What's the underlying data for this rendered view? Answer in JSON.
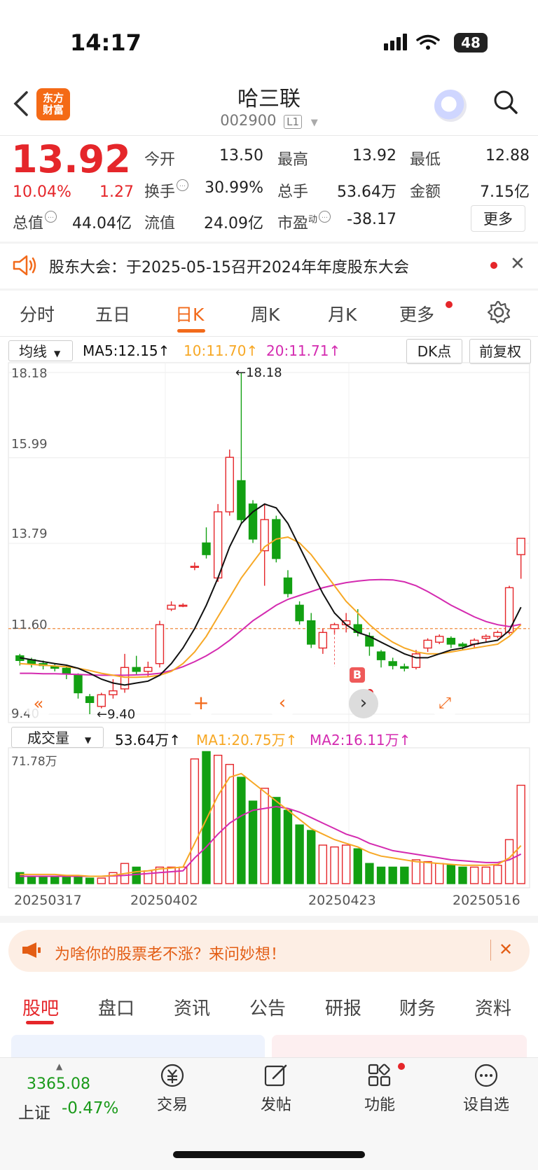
{
  "status_bar": {
    "time": "14:17",
    "battery": "48"
  },
  "header": {
    "back_icon": "chevron-left-icon",
    "logo_line1": "东方",
    "logo_line2": "财富",
    "title": "哈三联",
    "code": "002900",
    "level": "L1"
  },
  "quote": {
    "price": "13.92",
    "change_pct": "10.04%",
    "change": "1.27",
    "fields": [
      {
        "label": "今开",
        "value": "13.50",
        "color": "#e5262a"
      },
      {
        "label": "最高",
        "value": "13.92",
        "color": "#e5262a"
      },
      {
        "label": "最低",
        "value": "12.88",
        "color": "#e5262a"
      },
      {
        "label": "换手",
        "value": "30.99%",
        "color": "#222222"
      },
      {
        "label": "总手",
        "value": "53.64万",
        "color": "#222222"
      },
      {
        "label": "金额",
        "value": "7.15亿",
        "color": "#222222"
      },
      {
        "label": "总值",
        "value": "44.04亿",
        "color": "#222222"
      },
      {
        "label": "流值",
        "value": "24.09亿",
        "color": "#222222"
      },
      {
        "label": "市盈",
        "value": "-38.17",
        "color": "#222222"
      }
    ],
    "pe_superscript": "动",
    "more_label": "更多"
  },
  "notice": {
    "text": "股东大会：于2025-05-15召开2024年年度股东大会"
  },
  "chart_tabs": [
    "分时",
    "五日",
    "日K",
    "周K",
    "月K",
    "更多"
  ],
  "chart_tabs_active": 2,
  "ma_bar": {
    "select_label": "均线",
    "ma5": "MA5:12.15↑",
    "ma10": "10:11.70↑",
    "ma20": "20:11.71↑",
    "dk_label": "DK点",
    "adjust_label": "前复权"
  },
  "kline": {
    "y_labels": [
      "18.18",
      "15.99",
      "13.79",
      "11.60",
      "9.40"
    ],
    "max_label": "←18.18",
    "min_label": "←9.40",
    "b_marker": "B",
    "colors": {
      "up": "#e5262a",
      "down": "#12a012",
      "ma5": "#111111",
      "ma10": "#f7a825",
      "ma20": "#d42bb0"
    }
  },
  "volume_bar": {
    "select_label": "成交量",
    "value": "53.64万↑",
    "ma1": "MA1:20.75万↑",
    "ma2": "MA2:16.11万↑",
    "max_label": "71.78万"
  },
  "x_dates": [
    "20250317",
    "20250402",
    "20250423",
    "20250516"
  ],
  "chart_data": {
    "type": "candlestick",
    "ylim": [
      9.4,
      18.18
    ],
    "candles": [
      [
        10.9,
        10.78,
        10.95,
        10.65
      ],
      [
        10.8,
        10.7,
        10.85,
        10.6
      ],
      [
        10.7,
        10.65,
        10.78,
        10.55
      ],
      [
        10.62,
        10.58,
        10.7,
        10.5
      ],
      [
        10.58,
        10.45,
        10.65,
        10.3
      ],
      [
        10.4,
        9.95,
        10.45,
        9.8
      ],
      [
        9.85,
        9.7,
        9.92,
        9.4
      ],
      [
        9.6,
        9.9,
        9.95,
        9.55
      ],
      [
        9.9,
        10.0,
        10.3,
        9.8
      ],
      [
        10.05,
        10.6,
        10.95,
        9.95
      ],
      [
        10.6,
        10.5,
        10.9,
        10.4
      ],
      [
        10.5,
        10.6,
        10.75,
        10.35
      ],
      [
        10.7,
        11.7,
        11.8,
        10.6
      ],
      [
        12.1,
        12.2,
        12.3,
        12.05
      ],
      [
        12.2,
        12.2,
        12.25,
        12.15
      ],
      [
        13.2,
        13.2,
        13.3,
        13.1
      ],
      [
        13.8,
        13.5,
        14.2,
        13.4
      ],
      [
        12.9,
        14.6,
        14.8,
        12.8
      ],
      [
        14.6,
        16.0,
        16.2,
        14.5
      ],
      [
        15.4,
        14.4,
        18.18,
        14.3
      ],
      [
        14.8,
        13.9,
        14.9,
        13.8
      ],
      [
        13.6,
        14.4,
        14.8,
        12.7
      ],
      [
        14.4,
        13.4,
        14.5,
        13.3
      ],
      [
        12.9,
        12.5,
        13.1,
        12.4
      ],
      [
        12.2,
        11.8,
        12.3,
        11.7
      ],
      [
        11.8,
        11.2,
        12.0,
        11.1
      ],
      [
        11.1,
        11.5,
        11.6,
        10.95
      ],
      [
        11.6,
        11.7,
        11.75,
        11.45
      ],
      [
        11.7,
        11.8,
        12.0,
        11.5
      ],
      [
        11.7,
        11.5,
        12.1,
        11.4
      ],
      [
        11.4,
        11.15,
        11.5,
        10.9
      ],
      [
        11.0,
        10.8,
        11.05,
        10.6
      ],
      [
        10.75,
        10.65,
        10.85,
        10.55
      ],
      [
        10.62,
        10.58,
        10.7,
        10.5
      ],
      [
        10.6,
        10.95,
        11.05,
        10.55
      ],
      [
        11.1,
        11.3,
        11.35,
        11.0
      ],
      [
        11.25,
        11.4,
        11.45,
        11.2
      ],
      [
        11.35,
        11.2,
        11.4,
        11.1
      ],
      [
        11.2,
        11.15,
        11.25,
        11.05
      ],
      [
        11.2,
        11.3,
        11.35,
        11.1
      ],
      [
        11.35,
        11.4,
        11.45,
        11.25
      ],
      [
        11.4,
        11.5,
        11.55,
        11.35
      ],
      [
        11.5,
        12.65,
        12.7,
        11.45
      ],
      [
        13.5,
        13.92,
        13.92,
        12.88
      ]
    ],
    "ma5": [
      10.85,
      10.8,
      10.75,
      10.7,
      10.66,
      10.58,
      10.45,
      10.3,
      10.2,
      10.15,
      10.2,
      10.25,
      10.4,
      10.7,
      11.1,
      11.6,
      12.2,
      12.9,
      13.7,
      14.3,
      14.6,
      14.8,
      14.7,
      14.3,
      13.7,
      13.1,
      12.5,
      12.0,
      11.7,
      11.5,
      11.4,
      11.25,
      11.1,
      10.95,
      10.85,
      10.85,
      10.95,
      11.05,
      11.1,
      11.2,
      11.25,
      11.3,
      11.55,
      12.15
    ],
    "ma10": [
      10.7,
      10.68,
      10.66,
      10.64,
      10.62,
      10.58,
      10.52,
      10.45,
      10.4,
      10.35,
      10.35,
      10.36,
      10.4,
      10.5,
      10.7,
      11.0,
      11.4,
      11.9,
      12.4,
      12.9,
      13.3,
      13.7,
      13.9,
      13.95,
      13.8,
      13.5,
      13.1,
      12.7,
      12.3,
      12.0,
      11.7,
      11.45,
      11.25,
      11.1,
      11.0,
      10.95,
      10.95,
      11.0,
      11.05,
      11.1,
      11.15,
      11.2,
      11.4,
      11.7
    ],
    "ma20": [
      10.45,
      10.45,
      10.44,
      10.44,
      10.43,
      10.42,
      10.41,
      10.4,
      10.4,
      10.4,
      10.41,
      10.42,
      10.45,
      10.52,
      10.62,
      10.75,
      10.9,
      11.08,
      11.3,
      11.55,
      11.8,
      12.0,
      12.2,
      12.35,
      12.45,
      12.55,
      12.65,
      12.72,
      12.78,
      12.82,
      12.85,
      12.86,
      12.85,
      12.8,
      12.7,
      12.55,
      12.38,
      12.2,
      12.05,
      11.9,
      11.78,
      11.7,
      11.65,
      11.71
    ],
    "volumes": [
      6,
      4,
      4,
      4,
      4,
      4,
      3,
      3,
      6,
      11,
      9,
      7,
      9,
      9,
      9,
      68,
      72,
      70,
      65,
      58,
      45,
      52,
      47,
      40,
      32,
      29,
      21,
      20,
      21,
      19,
      11,
      9,
      9,
      9,
      13,
      12,
      11,
      10,
      9,
      9,
      9,
      10,
      24,
      53.64
    ],
    "vol_ma1": [
      5,
      5,
      5,
      5,
      4.5,
      4.5,
      4,
      4,
      4.5,
      5.5,
      6.5,
      7,
      8,
      8.5,
      9,
      22,
      35,
      48,
      58,
      60,
      55,
      50,
      45,
      40,
      35,
      30,
      27,
      24,
      22,
      20,
      17,
      15,
      14,
      13,
      12,
      11.5,
      11,
      10.5,
      10,
      10,
      10,
      10.5,
      14,
      20.75
    ],
    "vol_ma2": [
      4,
      4,
      4,
      4,
      4,
      4,
      4,
      4,
      4.2,
      4.5,
      5,
      5.5,
      6,
      6.5,
      7,
      14,
      20,
      27,
      33,
      37,
      40,
      41,
      42,
      41,
      39,
      36,
      33,
      30,
      27,
      25,
      22,
      20,
      18,
      17,
      16,
      15,
      14,
      13,
      12.5,
      12,
      11.5,
      11.5,
      13,
      16.11
    ],
    "vol_ylim": [
      0,
      71.78
    ]
  },
  "ad_banner": {
    "text": "为啥你的股票老不涨？来问妙想！"
  },
  "bottom_tabs": [
    "股吧",
    "盘口",
    "资讯",
    "公告",
    "研报",
    "财务",
    "资料"
  ],
  "bottom_tabs_active": 0,
  "dock": {
    "index_value": "3365.08",
    "index_name": "上证",
    "index_change": "-0.47%",
    "items": [
      {
        "label": "交易",
        "icon": "yuan-exchange-icon"
      },
      {
        "label": "发帖",
        "icon": "edit-post-icon"
      },
      {
        "label": "功能",
        "icon": "grid-apps-icon"
      },
      {
        "label": "设自选",
        "icon": "more-dots-icon"
      }
    ]
  }
}
